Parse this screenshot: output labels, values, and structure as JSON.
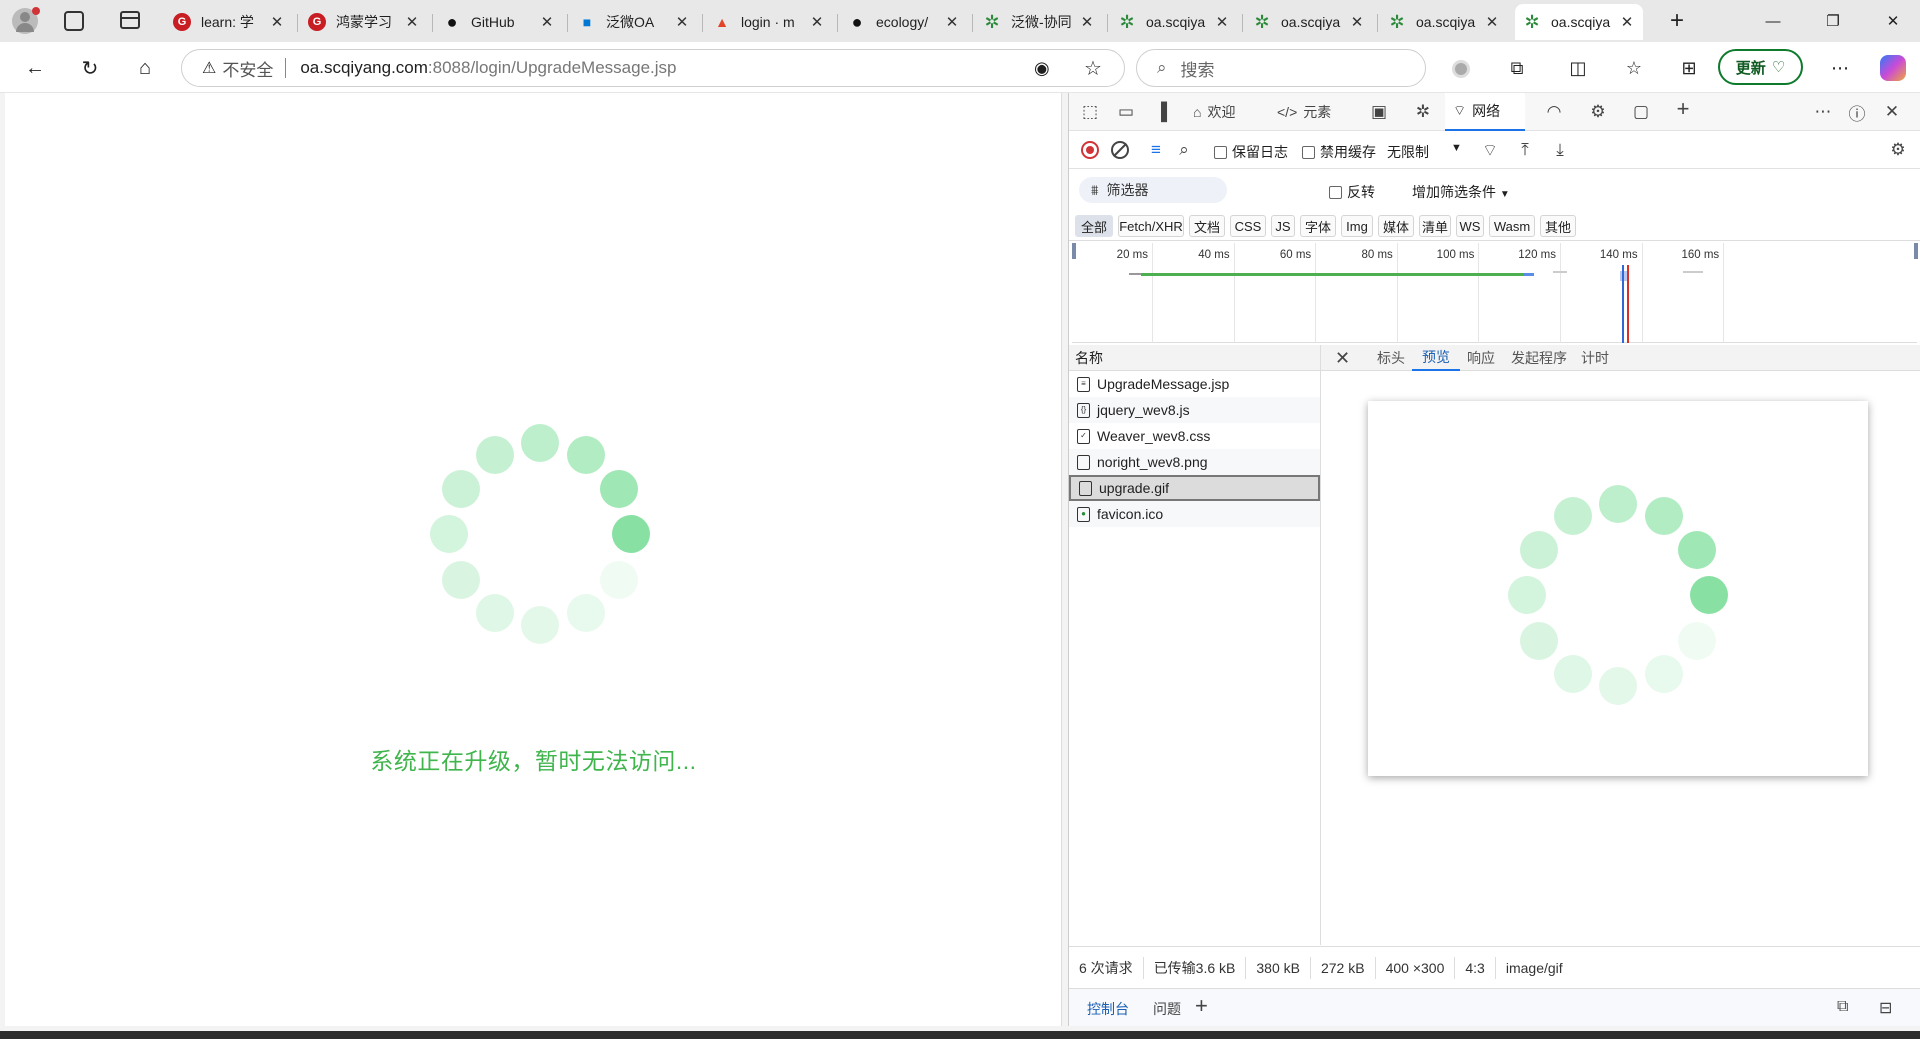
{
  "tabs": [
    {
      "title": "learn: 学",
      "icon": "gitee-icon",
      "color": "#c71d23"
    },
    {
      "title": "鸿蒙学习",
      "icon": "gitee-icon",
      "color": "#c71d23"
    },
    {
      "title": "GitHub",
      "icon": "github-icon",
      "color": "#111"
    },
    {
      "title": "泛微OA",
      "icon": "windows-icon",
      "color": "#0078d4"
    },
    {
      "title": "login · m",
      "icon": "gitlab-icon",
      "color": "#e24329"
    },
    {
      "title": "ecology/",
      "icon": "github-icon",
      "color": "#111"
    },
    {
      "title": "泛微-协同",
      "icon": "weaver-icon",
      "color": "#2a8a3a"
    },
    {
      "title": "oa.scqiya",
      "icon": "weaver-icon",
      "color": "#2a8a3a"
    },
    {
      "title": "oa.scqiya",
      "icon": "weaver-icon",
      "color": "#2a8a3a"
    },
    {
      "title": "oa.scqiya",
      "icon": "weaver-icon",
      "color": "#2a8a3a"
    },
    {
      "title": "oa.scqiya",
      "icon": "weaver-icon",
      "color": "#2a8a3a",
      "active": true
    }
  ],
  "address": {
    "insecure_label": "不安全",
    "host": "oa.scqiyang.com",
    "rest": ":8088/login/UpgradeMessage.jsp"
  },
  "search": {
    "placeholder": "搜索"
  },
  "update_button": "更新",
  "page": {
    "message": "系统正在升级，暂时无法访问..."
  },
  "devtools": {
    "tabs": {
      "welcome": "欢迎",
      "elements": "元素",
      "network": "网络"
    },
    "toolbar": {
      "preserve_log": "保留日志",
      "disable_cache": "禁用缓存",
      "throttle": "无限制"
    },
    "filter": {
      "placeholder": "筛选器",
      "invert": "反转",
      "more_filters": "增加筛选条件"
    },
    "types": [
      "全部",
      "Fetch/XHR",
      "文档",
      "CSS",
      "JS",
      "字体",
      "Img",
      "媒体",
      "清单",
      "WS",
      "Wasm",
      "其他"
    ],
    "timeline_ticks": [
      "20 ms",
      "40 ms",
      "60 ms",
      "80 ms",
      "100 ms",
      "120 ms",
      "140 ms",
      "160 ms"
    ],
    "name_header": "名称",
    "requests": [
      {
        "name": "UpgradeMessage.jsp",
        "icon": "document-icon"
      },
      {
        "name": "jquery_wev8.js",
        "icon": "script-icon"
      },
      {
        "name": "Weaver_wev8.css",
        "icon": "stylesheet-icon"
      },
      {
        "name": "noright_wev8.png",
        "icon": "image-file-icon"
      },
      {
        "name": "upgrade.gif",
        "icon": "image-file-icon",
        "selected": true
      },
      {
        "name": "favicon.ico",
        "icon": "favicon-file-icon"
      }
    ],
    "preview_tabs": [
      "标头",
      "预览",
      "响应",
      "发起程序",
      "计时"
    ],
    "status": [
      "6 次请求",
      "已传输3.6 kB",
      "380 kB",
      "272 kB",
      "400 ×300",
      "4:3",
      "image/gif"
    ],
    "drawer": {
      "console": "控制台",
      "issues": "问题"
    }
  },
  "colors": {
    "accent": "#1a73e8",
    "spinner": "#3fcf6a",
    "message": "#3fb54c"
  }
}
